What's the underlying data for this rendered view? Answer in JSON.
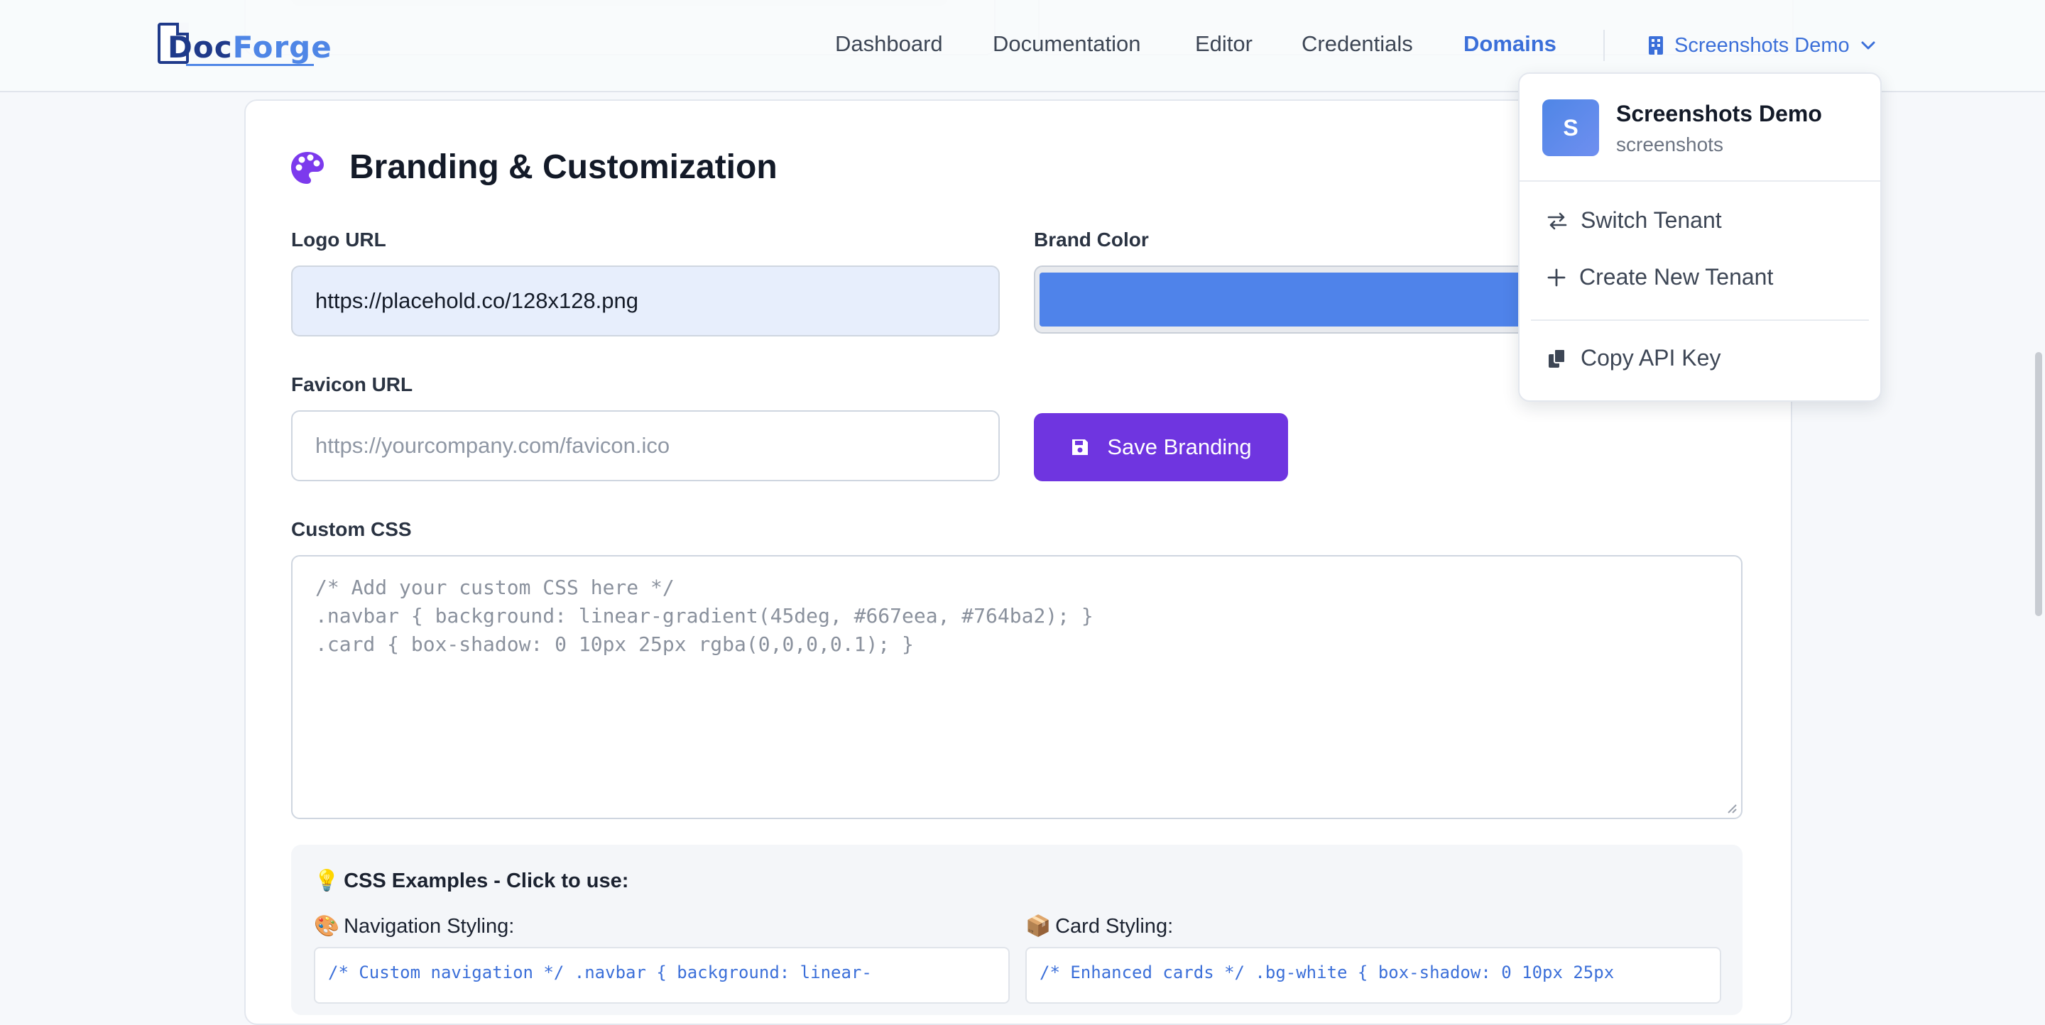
{
  "brand": {
    "logo_text_part1": "Doc",
    "logo_text_part2": "Forge"
  },
  "nav": {
    "items": [
      {
        "label": "Dashboard",
        "active": false
      },
      {
        "label": "Documentation",
        "active": false
      },
      {
        "label": "Editor",
        "active": false
      },
      {
        "label": "Credentials",
        "active": false
      },
      {
        "label": "Domains",
        "active": true
      }
    ],
    "tenant_label": "Screenshots Demo",
    "tenant_icon": "building-icon",
    "tenant_chevron": "chevron-down-icon"
  },
  "branding": {
    "title": "Branding & Customization",
    "title_icon": "palette-icon",
    "logo_url_label": "Logo URL",
    "logo_url_value": "https://placehold.co/128x128.png",
    "brand_color_label": "Brand Color",
    "brand_color_value": "#4f83ea",
    "favicon_label": "Favicon URL",
    "favicon_placeholder": "https://yourcompany.com/favicon.ico",
    "save_button": "Save Branding",
    "save_icon": "floppy-disk-icon",
    "custom_css_label": "Custom CSS",
    "custom_css_placeholder": [
      "/* Add your custom CSS here */",
      ".navbar { background: linear-gradient(45deg, #667eea, #764ba2); }",
      ".card { box-shadow: 0 10px 25px rgba(0,0,0,0.1); }"
    ]
  },
  "examples": {
    "heading": "CSS Examples - Click to use:",
    "heading_emoji": "💡",
    "nav_emoji": "🎨",
    "nav_title": "Navigation Styling:",
    "nav_code": "/* Custom navigation */ .navbar { background: linear-",
    "card_emoji": "📦",
    "card_title": "Card Styling:",
    "card_code": "/* Enhanced cards */ .bg-white { box-shadow: 0 10px 25px"
  },
  "tenant_menu": {
    "avatar_letter": "S",
    "name": "Screenshots Demo",
    "slug": "screenshots",
    "switch_label": "Switch Tenant",
    "switch_icon": "swap-arrows-icon",
    "create_label": "Create New Tenant",
    "create_icon": "plus-icon",
    "copy_label": "Copy API Key",
    "copy_icon": "copy-icon"
  },
  "colors": {
    "accent": "#3b6fd9",
    "primary_button": "#6f35e0",
    "palette_icon": "#7c3aed"
  }
}
